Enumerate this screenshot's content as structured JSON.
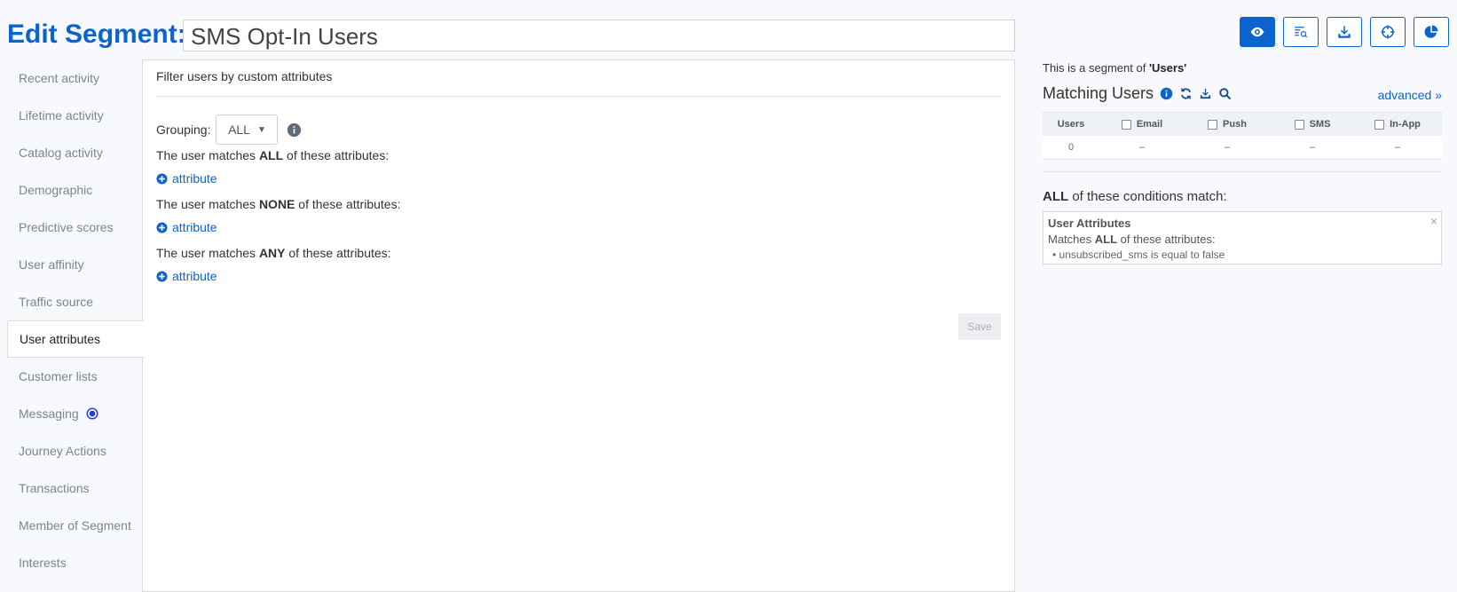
{
  "header": {
    "title": "Edit Segment:",
    "segment_name": "SMS Opt-In Users"
  },
  "toolbar": {
    "buttons": [
      "eye-icon",
      "list-search-icon",
      "download-icon",
      "crosshair-icon",
      "pie-chart-icon"
    ],
    "active_color": "#0b63ce"
  },
  "sidebar": {
    "items": [
      {
        "label": "Recent activity"
      },
      {
        "label": "Lifetime activity"
      },
      {
        "label": "Catalog activity"
      },
      {
        "label": "Demographic"
      },
      {
        "label": "Predictive scores"
      },
      {
        "label": "User affinity"
      },
      {
        "label": "Traffic source"
      },
      {
        "label": "User attributes",
        "active": true
      },
      {
        "label": "Customer lists"
      },
      {
        "label": "Messaging"
      },
      {
        "label": "Journey Actions"
      },
      {
        "label": "Transactions"
      },
      {
        "label": "Member of Segment"
      },
      {
        "label": "Interests"
      }
    ]
  },
  "panel": {
    "title": "Filter users by custom attributes",
    "grouping_label": "Grouping:",
    "grouping_value": "ALL",
    "rules": [
      {
        "prefix": "The user matches ",
        "keyword": "ALL",
        "suffix": " of these attributes:"
      },
      {
        "prefix": "The user matches ",
        "keyword": "NONE",
        "suffix": " of these attributes:"
      },
      {
        "prefix": "The user matches ",
        "keyword": "ANY",
        "suffix": " of these attributes:"
      }
    ],
    "add_attribute_label": "attribute",
    "save_label": "Save"
  },
  "right": {
    "segment_of_prefix": "This is a segment of ",
    "segment_of_value": "'Users'",
    "matching_title": "Matching Users",
    "advanced_label": "advanced »",
    "columns": [
      "Users",
      "Email",
      "Push",
      "SMS",
      "In-App"
    ],
    "values": [
      "0",
      "–",
      "–",
      "–",
      "–"
    ],
    "conditions_keyword": "ALL",
    "conditions_suffix": " of these conditions match:",
    "condition": {
      "title": "User Attributes",
      "sub_prefix": "Matches ",
      "sub_keyword": "ALL",
      "sub_suffix": " of these attributes:",
      "item": "• unsubscribed_sms is equal to false",
      "close": "×"
    }
  }
}
